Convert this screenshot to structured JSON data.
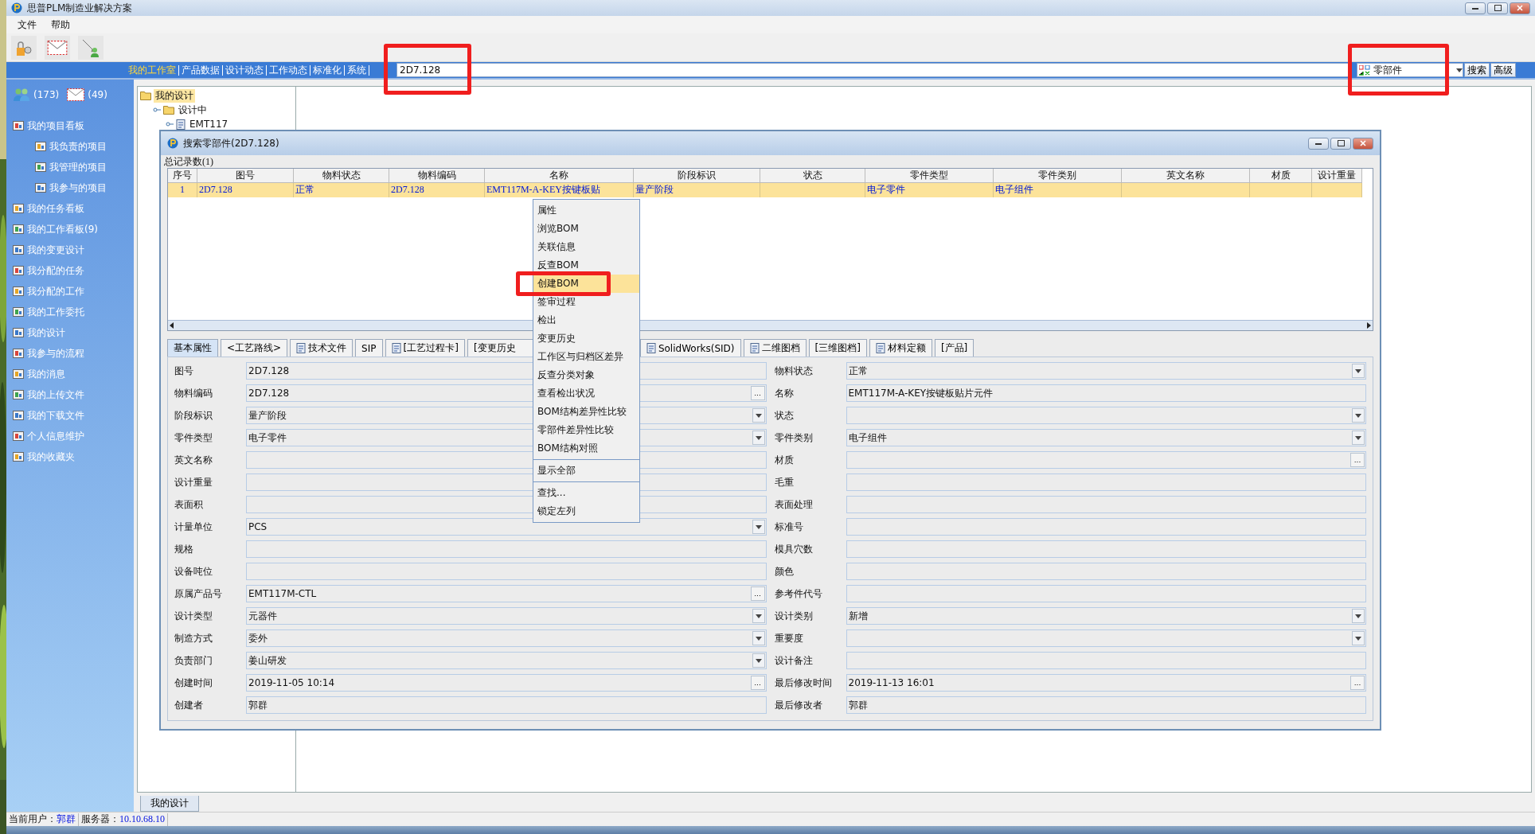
{
  "window": {
    "title": "思普PLM制造业解决方案"
  },
  "menu": [
    "文件",
    "帮助"
  ],
  "nav": {
    "links": [
      {
        "label": "我的工作室",
        "selected": true
      },
      {
        "label": "产品数据",
        "selected": false
      },
      {
        "label": "设计动态",
        "selected": false
      },
      {
        "label": "工作动态",
        "selected": false
      },
      {
        "label": "标准化",
        "selected": false
      },
      {
        "label": "系统",
        "selected": false
      }
    ],
    "search": {
      "value": "2D7.128",
      "annotated": true
    },
    "type_select": {
      "value": "零部件",
      "annotated": true
    },
    "buttons": [
      "搜索",
      "高级"
    ]
  },
  "sidebar": {
    "counters": [
      {
        "kind": "users",
        "text": "(173)"
      },
      {
        "kind": "mail",
        "text": "(49)"
      }
    ],
    "items": [
      {
        "label": "我的项目看板",
        "children": [
          {
            "label": "我负责的项目"
          },
          {
            "label": "我管理的项目"
          },
          {
            "label": "我参与的项目"
          }
        ]
      },
      {
        "label": "我的任务看板"
      },
      {
        "label": "我的工作看板(9)"
      },
      {
        "label": "我的变更设计"
      },
      {
        "label": "我分配的任务"
      },
      {
        "label": "我分配的工作"
      },
      {
        "label": "我的工作委托"
      },
      {
        "label": "我的设计"
      },
      {
        "label": "我参与的流程"
      },
      {
        "label": "我的消息"
      },
      {
        "label": "我的上传文件"
      },
      {
        "label": "我的下载文件"
      },
      {
        "label": "个人信息维护"
      },
      {
        "label": "我的收藏夹"
      }
    ]
  },
  "tree": [
    {
      "label": "我的设计",
      "selected": true,
      "children": [
        {
          "label": "设计中",
          "selected": false,
          "children": [
            {
              "label": "EMT117",
              "selected": false
            }
          ]
        }
      ]
    }
  ],
  "bottom_tabs": [
    {
      "label": "我的设计",
      "selected": true
    }
  ],
  "status_bar": {
    "user_label": "当前用户：",
    "user": "郭群",
    "server_label": "服务器：",
    "server": "10.10.68.10"
  },
  "dialog": {
    "title": "搜索零部件(2D7.128)",
    "record_count": "总记录数(1)",
    "table": {
      "columns": [
        "序号",
        "图号",
        "物料状态",
        "物料编码",
        "名称",
        "阶段标识",
        "状态",
        "零件类型",
        "零件类别",
        "英文名称",
        "材质",
        "设计重量"
      ],
      "rows": [
        {
          "selected": true,
          "cells": [
            "1",
            "2D7.128",
            "正常",
            "2D7.128",
            "EMT117M-A-KEY按键板贴",
            "量产阶段",
            "",
            "电子零件",
            "电子组件",
            "",
            "",
            ""
          ]
        }
      ]
    },
    "tabs": [
      {
        "label": "基本属性",
        "selected": true,
        "icon": false
      },
      {
        "label": "<工艺路线>",
        "selected": false,
        "icon": false
      },
      {
        "label": "技术文件",
        "selected": false,
        "icon": true
      },
      {
        "label": "SIP",
        "selected": false,
        "icon": false
      },
      {
        "label": "[工艺过程卡]",
        "selected": false,
        "icon": true
      },
      {
        "label": "[变更历史",
        "selected": false,
        "icon": false
      },
      {
        "label": "SolidWorks(SID)",
        "selected": false,
        "icon": true
      },
      {
        "label": "二维图档",
        "selected": false,
        "icon": true
      },
      {
        "label": "[三维图档]",
        "selected": false,
        "icon": false
      },
      {
        "label": "材料定额",
        "selected": false,
        "icon": true
      },
      {
        "label": "[产品]",
        "selected": false,
        "icon": false
      }
    ],
    "form": {
      "left": [
        {
          "label": "图号",
          "value": "2D7.128",
          "kind": "text"
        },
        {
          "label": "物料编码",
          "value": "2D7.128",
          "kind": "lookup",
          "button": "..."
        },
        {
          "label": "阶段标识",
          "value": "量产阶段",
          "kind": "select"
        },
        {
          "label": "零件类型",
          "value": "电子零件",
          "kind": "select"
        },
        {
          "label": "英文名称",
          "kind": "text"
        },
        {
          "label": "设计重量",
          "kind": "text"
        },
        {
          "label": "表面积",
          "kind": "text"
        },
        {
          "label": "计量单位",
          "value": "PCS",
          "kind": "select"
        },
        {
          "label": "规格",
          "kind": "text"
        },
        {
          "label": "设备吨位",
          "kind": "text"
        },
        {
          "label": "原属产品号",
          "value": "EMT117M-CTL",
          "kind": "lookup",
          "button": "..."
        },
        {
          "label": "设计类型",
          "value": "元器件",
          "kind": "select"
        },
        {
          "label": "制造方式",
          "value": "委外",
          "kind": "select"
        },
        {
          "label": "负责部门",
          "value": "姜山研发",
          "kind": "select"
        },
        {
          "label": "创建时间",
          "value": "2019-11-05 10:14",
          "kind": "lookup",
          "button": "..."
        },
        {
          "label": "创建者",
          "value": "郭群",
          "kind": "text"
        }
      ],
      "right": [
        {
          "label": "物料状态",
          "value": "正常",
          "kind": "select"
        },
        {
          "label": "名称",
          "value": "EMT117M-A-KEY按键板贴片元件",
          "kind": "text"
        },
        {
          "label": "状态",
          "kind": "select"
        },
        {
          "label": "零件类别",
          "value": "电子组件",
          "kind": "select"
        },
        {
          "label": "材质",
          "kind": "lookup",
          "button": "..."
        },
        {
          "label": "毛重",
          "kind": "text"
        },
        {
          "label": "表面处理",
          "kind": "text"
        },
        {
          "label": "标准号",
          "kind": "text"
        },
        {
          "label": "模具穴数",
          "kind": "text"
        },
        {
          "label": "颜色",
          "kind": "text"
        },
        {
          "label": "参考件代号",
          "kind": "text"
        },
        {
          "label": "设计类别",
          "value": "新增",
          "kind": "select"
        },
        {
          "label": "重要度",
          "kind": "select"
        },
        {
          "label": "设计备注",
          "kind": "text"
        },
        {
          "label": "最后修改时间",
          "value": "2019-11-13 16:01",
          "kind": "lookup",
          "button": "..."
        },
        {
          "label": "最后修改者",
          "value": "郭群",
          "kind": "text"
        }
      ]
    },
    "context_menu": {
      "groups": [
        [
          {
            "label": "属性",
            "selected": false,
            "annotated": false
          },
          {
            "label": "浏览BOM",
            "selected": false,
            "annotated": false
          },
          {
            "label": "关联信息",
            "selected": false,
            "annotated": false
          },
          {
            "label": "反查BOM",
            "selected": false,
            "annotated": false
          },
          {
            "label": "创建BOM",
            "selected": true,
            "annotated": true
          },
          {
            "label": "签审过程",
            "selected": false,
            "annotated": false
          },
          {
            "label": "检出",
            "selected": false,
            "annotated": false
          },
          {
            "label": "变更历史",
            "selected": false,
            "annotated": false
          },
          {
            "label": "工作区与归档区差异",
            "selected": false,
            "annotated": false
          },
          {
            "label": "反查分类对象",
            "selected": false,
            "annotated": false
          },
          {
            "label": "查看检出状况",
            "selected": false,
            "annotated": false
          },
          {
            "label": "BOM结构差异性比较",
            "selected": false,
            "annotated": false
          },
          {
            "label": "零部件差异性比较",
            "selected": false,
            "annotated": false
          },
          {
            "label": "BOM结构对照",
            "selected": false,
            "annotated": false
          }
        ],
        [
          {
            "label": "显示全部",
            "selected": false,
            "annotated": false
          }
        ],
        [
          {
            "label": "查找...",
            "selected": false,
            "annotated": false
          },
          {
            "label": "锁定左列",
            "selected": false,
            "annotated": false
          }
        ]
      ]
    }
  }
}
